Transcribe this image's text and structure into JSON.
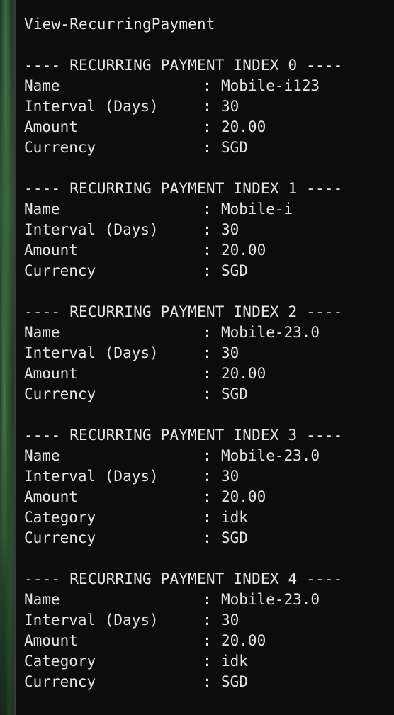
{
  "command": "View-RecurringPayment",
  "separator": ":",
  "records": [
    {
      "header": "---- RECURRING PAYMENT INDEX 0 ----",
      "fields": [
        {
          "label": "Name",
          "value": "Mobile-i123"
        },
        {
          "label": "Interval (Days)",
          "value": "30"
        },
        {
          "label": "Amount",
          "value": "20.00"
        },
        {
          "label": "Currency",
          "value": "SGD"
        }
      ]
    },
    {
      "header": "---- RECURRING PAYMENT INDEX 1 ----",
      "fields": [
        {
          "label": "Name",
          "value": "Mobile-i"
        },
        {
          "label": "Interval (Days)",
          "value": "30"
        },
        {
          "label": "Amount",
          "value": "20.00"
        },
        {
          "label": "Currency",
          "value": "SGD"
        }
      ]
    },
    {
      "header": "---- RECURRING PAYMENT INDEX 2 ----",
      "fields": [
        {
          "label": "Name",
          "value": "Mobile-23.0"
        },
        {
          "label": "Interval (Days)",
          "value": "30"
        },
        {
          "label": "Amount",
          "value": "20.00"
        },
        {
          "label": "Currency",
          "value": "SGD"
        }
      ]
    },
    {
      "header": "---- RECURRING PAYMENT INDEX 3 ----",
      "fields": [
        {
          "label": "Name",
          "value": "Mobile-23.0"
        },
        {
          "label": "Interval (Days)",
          "value": "30"
        },
        {
          "label": "Amount",
          "value": "20.00"
        },
        {
          "label": "Category",
          "value": "idk"
        },
        {
          "label": "Currency",
          "value": "SGD"
        }
      ]
    },
    {
      "header": "---- RECURRING PAYMENT INDEX 4 ----",
      "fields": [
        {
          "label": "Name",
          "value": "Mobile-23.0"
        },
        {
          "label": "Interval (Days)",
          "value": "30"
        },
        {
          "label": "Amount",
          "value": "20.00"
        },
        {
          "label": "Category",
          "value": "idk"
        },
        {
          "label": "Currency",
          "value": "SGD"
        }
      ]
    }
  ]
}
